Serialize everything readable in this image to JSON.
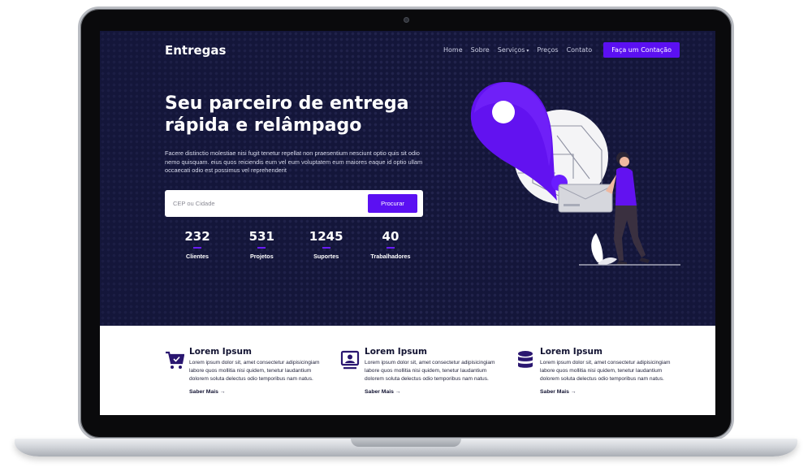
{
  "site": {
    "brand": "Entregas",
    "nav": {
      "items": [
        "Home",
        "Sobre",
        "Serviços",
        "Preços",
        "Contato"
      ],
      "cta": "Faça um Contação"
    }
  },
  "hero": {
    "title": "Seu parceiro de entrega rápida e relâmpago",
    "description": "Facere distinctio molestiae nisi fugit tenetur repellat non praesentium nesciunt optio quis sit odio nemo quisquam. eius quos reiciendis eum vel eum voluptatem eum maiores eaque id optio ullam occaecati odio est possimus vel reprehenderit",
    "search": {
      "placeholder": "CEP ou Cidade",
      "value": "",
      "button": "Procurar"
    },
    "stats": [
      {
        "value": "232",
        "label": "Clientes"
      },
      {
        "value": "531",
        "label": "Projetos"
      },
      {
        "value": "1245",
        "label": "Suportes"
      },
      {
        "value": "40",
        "label": "Trabalhadores"
      }
    ]
  },
  "features": [
    {
      "icon": "cart-check-icon",
      "title": "Lorem Ipsum",
      "text": "Lorem ipsum dolor sit, amet consectetur adipisicingiam labore quos mollitia nisi quidem, tenetur laudantium dolorem soluta delectus odio temporibus nam natus.",
      "link": "Saber Mais"
    },
    {
      "icon": "monitor-user-icon",
      "title": "Lorem Ipsum",
      "text": "Lorem ipsum dolor sit, amet consectetur adipisicingiam labore quos mollitia nisi quidem, tenetur laudantium dolorem soluta delectus odio temporibus nam natus.",
      "link": "Saber Mais"
    },
    {
      "icon": "database-icon",
      "title": "Lorem Ipsum",
      "text": "Lorem ipsum dolor sit, amet consectetur adipisicingiam labore quos mollitia nisi quidem, tenetur laudantium dolorem soluta delectus odio temporibus nam natus.",
      "link": "Saber Mais"
    }
  ],
  "colors": {
    "accent": "#5b10f2",
    "hero_bg": "#14163a"
  }
}
